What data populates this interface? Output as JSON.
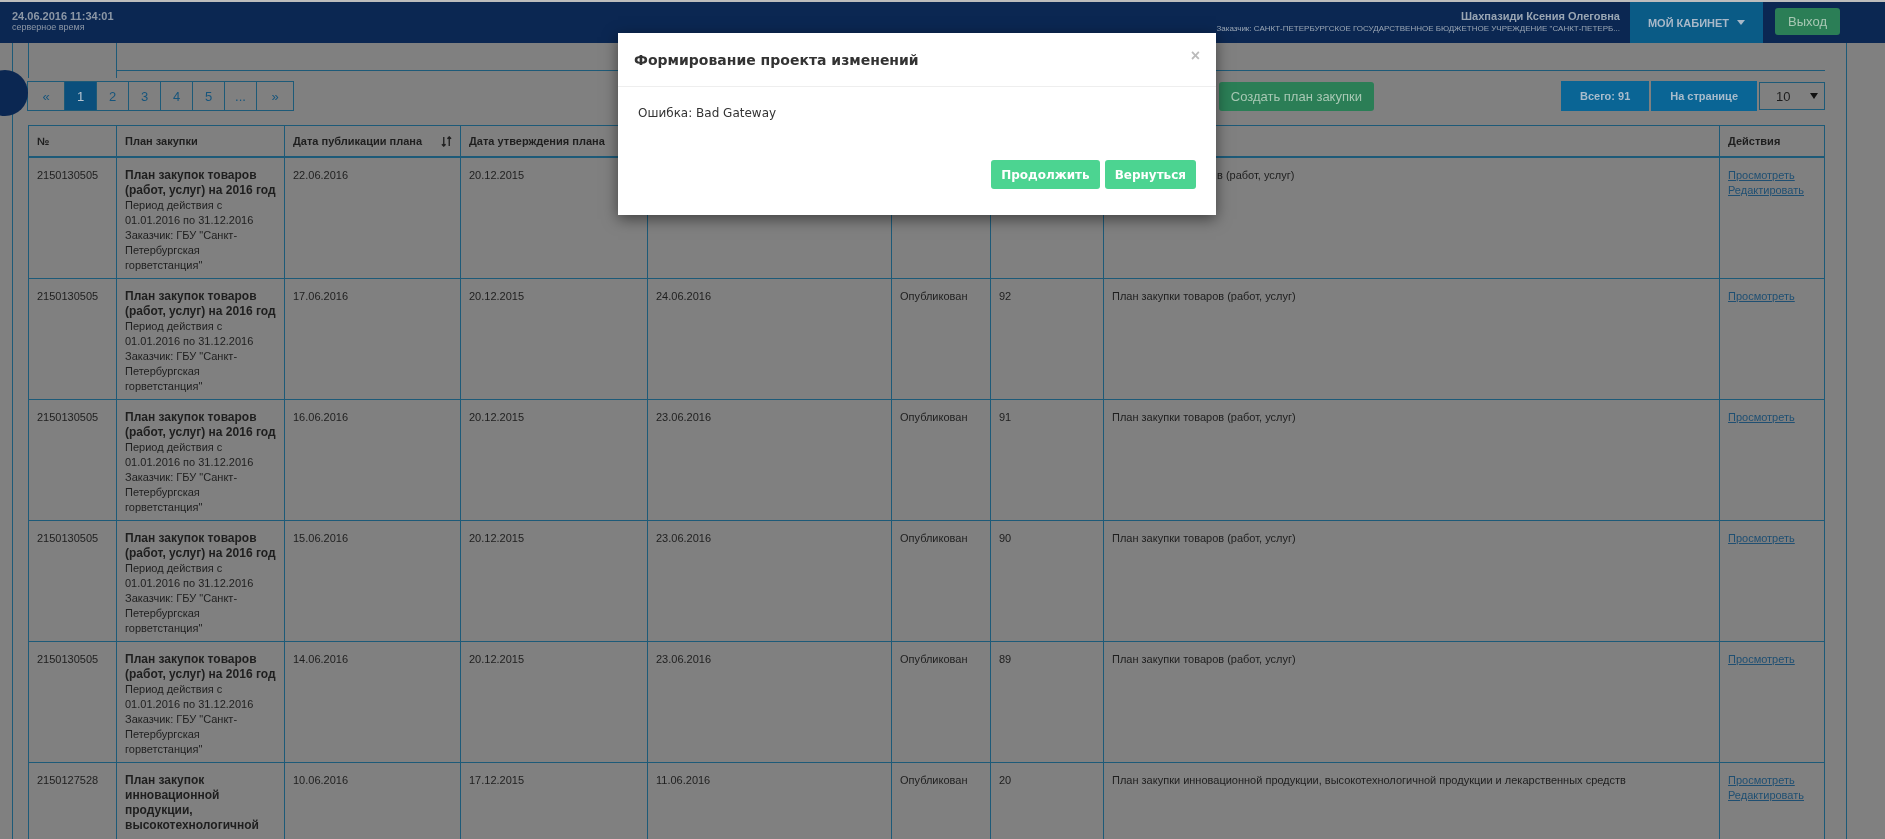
{
  "header": {
    "datetime": "24.06.2016 11:34:01",
    "datetime_caption": "серверное время",
    "user_name": "Шахпазиди Ксения Олеговна",
    "customer": "Заказчик: САНКТ-ПЕТЕРБУРГСКОЕ ГОСУДАРСТВЕННОЕ БЮДЖЕТНОЕ УЧРЕЖДЕНИЕ \"САНКТ-ПЕТЕРБ...",
    "cabinet_button": "МОЙ КАБИНЕТ",
    "logout_button": "Выход"
  },
  "pagination": [
    {
      "label": "«",
      "selected": false
    },
    {
      "label": "1",
      "selected": true
    },
    {
      "label": "2",
      "selected": false
    },
    {
      "label": "3",
      "selected": false
    },
    {
      "label": "4",
      "selected": false
    },
    {
      "label": "5",
      "selected": false
    },
    {
      "label": "...",
      "selected": false
    },
    {
      "label": "»",
      "selected": false
    }
  ],
  "toolbar": {
    "create_button": "Создать план закупки",
    "total": "Всего: 91",
    "per_page_label": "На странице",
    "per_page_value": "10"
  },
  "table": {
    "columns": [
      {
        "label": "№",
        "sortable": false
      },
      {
        "label": "План закупки",
        "sortable": false
      },
      {
        "label": "Дата публикации плана",
        "sortable": true
      },
      {
        "label": "Дата утверждения плана"
      },
      {
        "label": "Действия",
        "sortable": false
      }
    ],
    "rows": [
      {
        "number": "2150130505",
        "title": "План закупок товаров (работ, услуг) на 2016 год",
        "period": "Период действия с 01.01.2016 по 31.12.2016",
        "customer": "Заказчик: ГБУ \"Санкт-Петербургская горветстанция\"",
        "pub_date": "22.06.2016",
        "approve_date": "20.12.2015",
        "type": "в (работ, услуг)",
        "actions": [
          "Просмотреть",
          "Редактировать"
        ]
      },
      {
        "number": "2150130505",
        "title": "План закупок товаров (работ, услуг) на 2016 год",
        "period": "Период действия с 01.01.2016 по 31.12.2016",
        "customer": "Заказчик: ГБУ \"Санкт-Петербургская горветстанция\"",
        "pub_date": "17.06.2016",
        "approve_date": "20.12.2015",
        "column_5": "24.06.2016",
        "status": "Опубликован",
        "column_7": "92",
        "type": "План закупки товаров (работ, услуг)",
        "actions": [
          "Просмотреть"
        ]
      },
      {
        "number": "2150130505",
        "title": "План закупок товаров (работ, услуг) на 2016 год",
        "period": "Период действия с 01.01.2016 по 31.12.2016",
        "customer": "Заказчик: ГБУ \"Санкт-Петербургская горветстанция\"",
        "pub_date": "16.06.2016",
        "approve_date": "20.12.2015",
        "column_5": "23.06.2016",
        "status": "Опубликован",
        "column_7": "91",
        "type": "План закупки товаров (работ, услуг)",
        "actions": [
          "Просмотреть"
        ]
      },
      {
        "number": "2150130505",
        "title": "План закупок товаров (работ, услуг) на 2016 год",
        "period": "Период действия с 01.01.2016 по 31.12.2016",
        "customer": "Заказчик: ГБУ \"Санкт-Петербургская горветстанция\"",
        "pub_date": "15.06.2016",
        "approve_date": "20.12.2015",
        "column_5": "23.06.2016",
        "status": "Опубликован",
        "column_7": "90",
        "type": "План закупки товаров (работ, услуг)",
        "actions": [
          "Просмотреть"
        ]
      },
      {
        "number": "2150130505",
        "title": "План закупок товаров (работ, услуг) на 2016 год",
        "period": "Период действия с 01.01.2016 по 31.12.2016",
        "customer": "Заказчик: ГБУ \"Санкт-Петербургская горветстанция\"",
        "pub_date": "14.06.2016",
        "approve_date": "20.12.2015",
        "column_5": "23.06.2016",
        "status": "Опубликован",
        "column_7": "89",
        "type": "План закупки товаров (работ, услуг)",
        "actions": [
          "Просмотреть"
        ]
      },
      {
        "number": "2150127528",
        "title": "План закупок инновационной продукции, высокотехнологичной",
        "pub_date": "10.06.2016",
        "approve_date": "17.12.2015",
        "column_5": "11.06.2016",
        "status": "Опубликован",
        "column_7": "20",
        "type": "План закупки инновационной продукции, высокотехнологичной продукции и лекарственных средств",
        "actions": [
          "Просмотреть",
          "Редактировать"
        ]
      }
    ]
  },
  "dialog": {
    "title": "Формирование проекта изменений",
    "close": "×",
    "message": "Ошибка: Bad Gateway",
    "buttons": [
      "Продолжить",
      "Вернуться"
    ]
  }
}
